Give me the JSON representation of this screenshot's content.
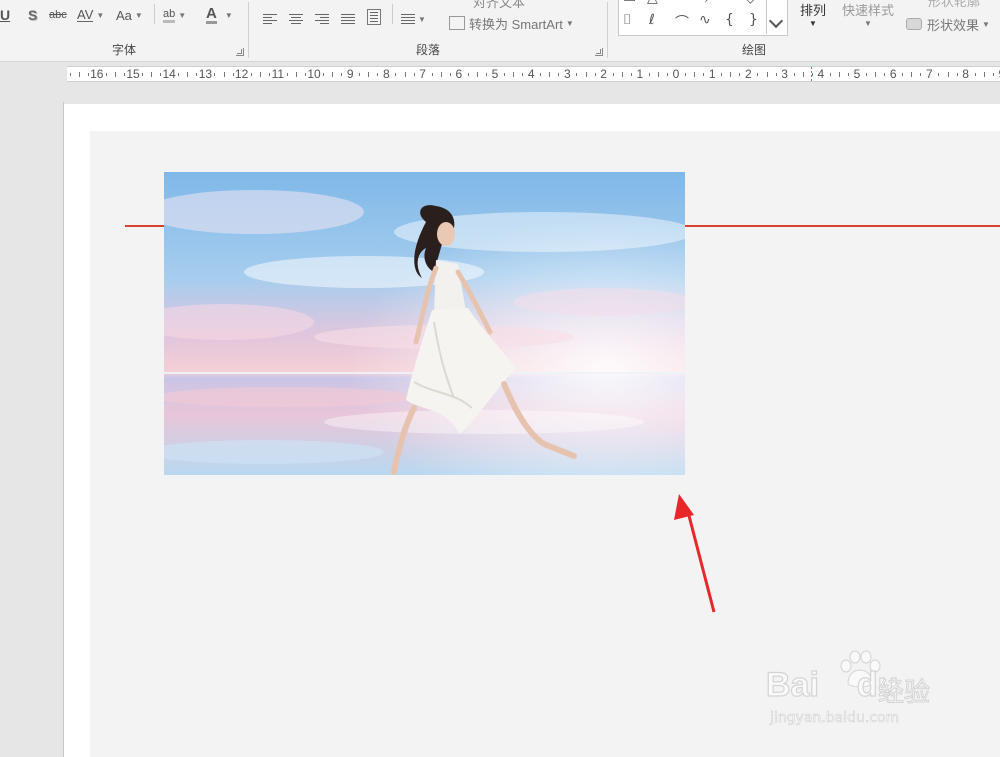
{
  "ribbon": {
    "font_group": {
      "label": "字体",
      "underline": "U",
      "shadow": "S",
      "strikethrough": "abc",
      "char_spacing": "AV",
      "change_case": "Aa",
      "highlight": "ab",
      "font_color": "A"
    },
    "paragraph_group": {
      "label": "段落",
      "text_direction_cut": "对齐文本",
      "smartart": "转换为 SmartArt"
    },
    "drawing_group": {
      "label": "绘图",
      "arrange": "排列",
      "quick_styles": "快速样式",
      "shape_outline_cut": "形状轮廓",
      "shape_effects": "形状效果"
    }
  },
  "ruler": {
    "labels": [
      "16",
      "15",
      "14",
      "13",
      "12",
      "11",
      "10",
      "9",
      "8",
      "7",
      "6",
      "5",
      "4",
      "3",
      "2",
      "1",
      "0",
      "1",
      "2",
      "3",
      "4",
      "5",
      "6",
      "7",
      "8",
      "9"
    ]
  },
  "watermark": {
    "logo": "Bai",
    "logo_suffix": "du",
    "logo_cn": "经验",
    "url": "jingyan.baidu.com"
  },
  "colors": {
    "accent_line": "#d7432f",
    "arrow": "#e8272a"
  }
}
